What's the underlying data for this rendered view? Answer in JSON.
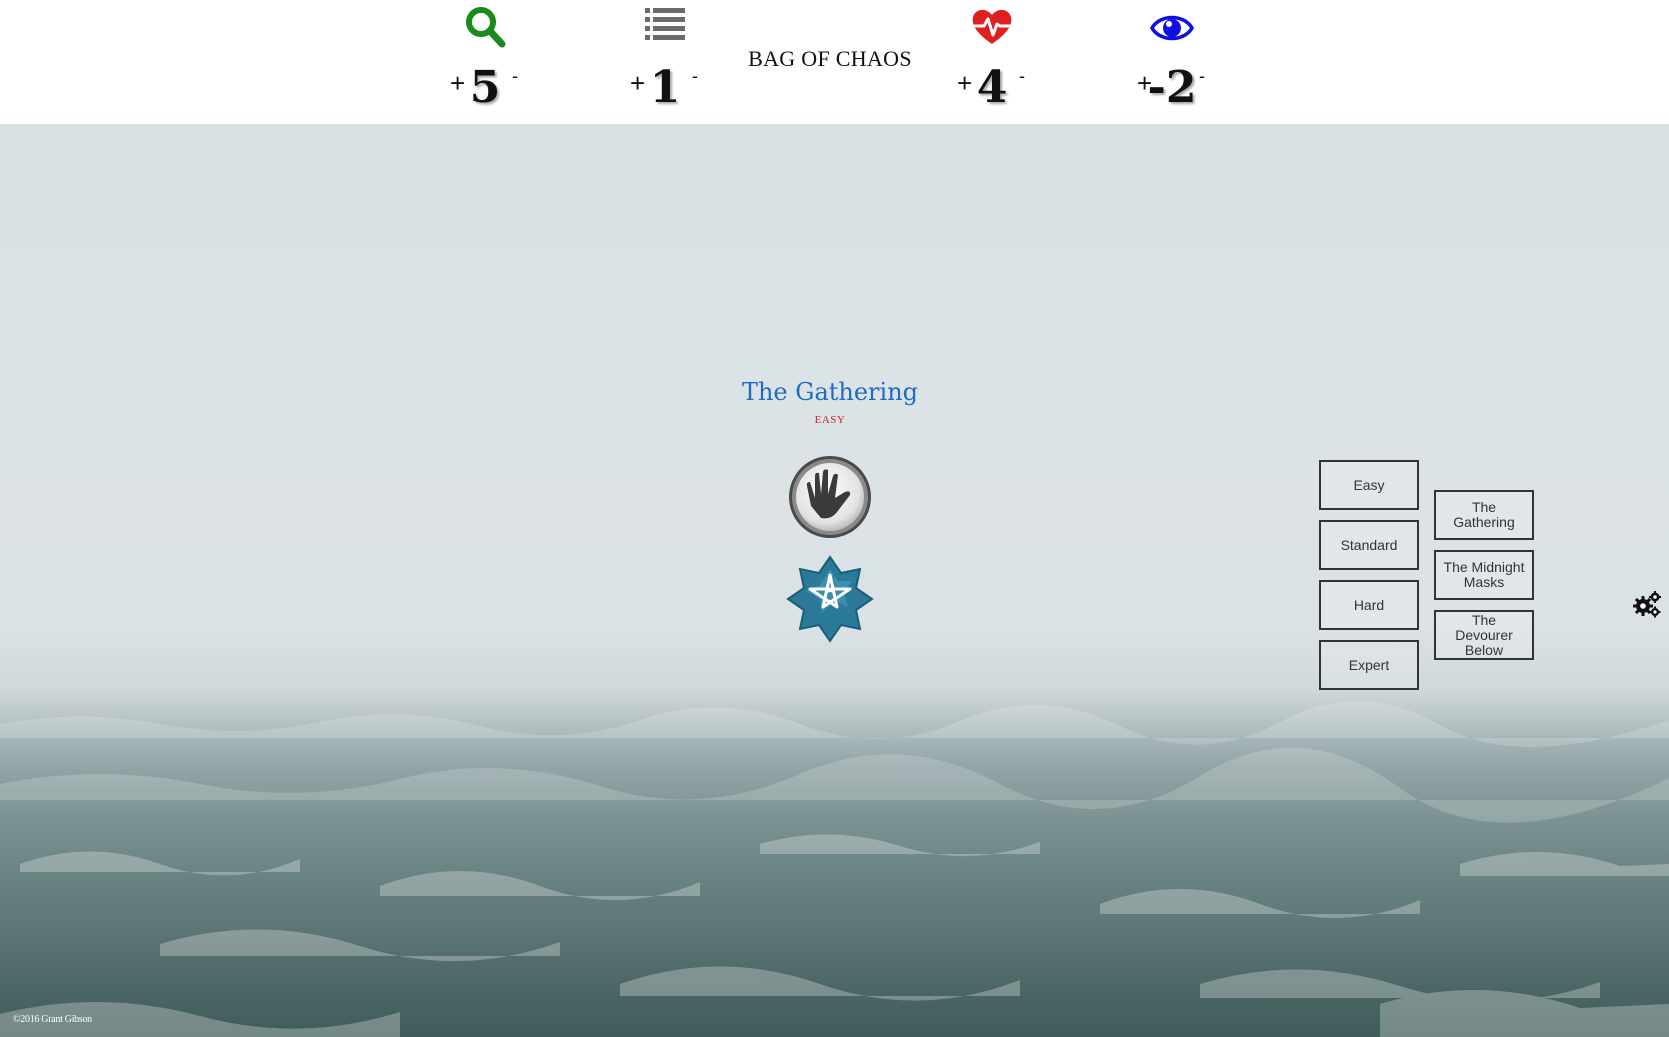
{
  "header": {
    "title": "BAG OF CHAOS",
    "stats": [
      {
        "id": "search",
        "icon": "magnifier-icon",
        "plus": "+",
        "value": "5",
        "minus": "-",
        "color": "#1a8a1a"
      },
      {
        "id": "list",
        "icon": "list-icon",
        "plus": "+",
        "value": "1",
        "minus": "-",
        "color": "#6b6b6b"
      },
      {
        "id": "health",
        "icon": "heartbeat-icon",
        "plus": "+",
        "value": "4",
        "minus": "-",
        "color": "#e02020"
      },
      {
        "id": "eye",
        "icon": "eye-icon",
        "plus": "+",
        "value": "-2",
        "minus": "-",
        "color": "#1010e0"
      }
    ]
  },
  "scenario": {
    "title": "The Gathering",
    "difficulty": "EASY"
  },
  "difficulty_buttons": [
    "Easy",
    "Standard",
    "Hard",
    "Expert"
  ],
  "scenario_buttons": [
    "The Gathering",
    "The Midnight Masks",
    "The Devourer Below"
  ],
  "footer": {
    "copyright": "©2016 Grant Gibson"
  },
  "colors": {
    "title_blue": "#1f6cbf",
    "difficulty_red": "#c62828",
    "elder_sign_teal": "#2b7a9a"
  }
}
